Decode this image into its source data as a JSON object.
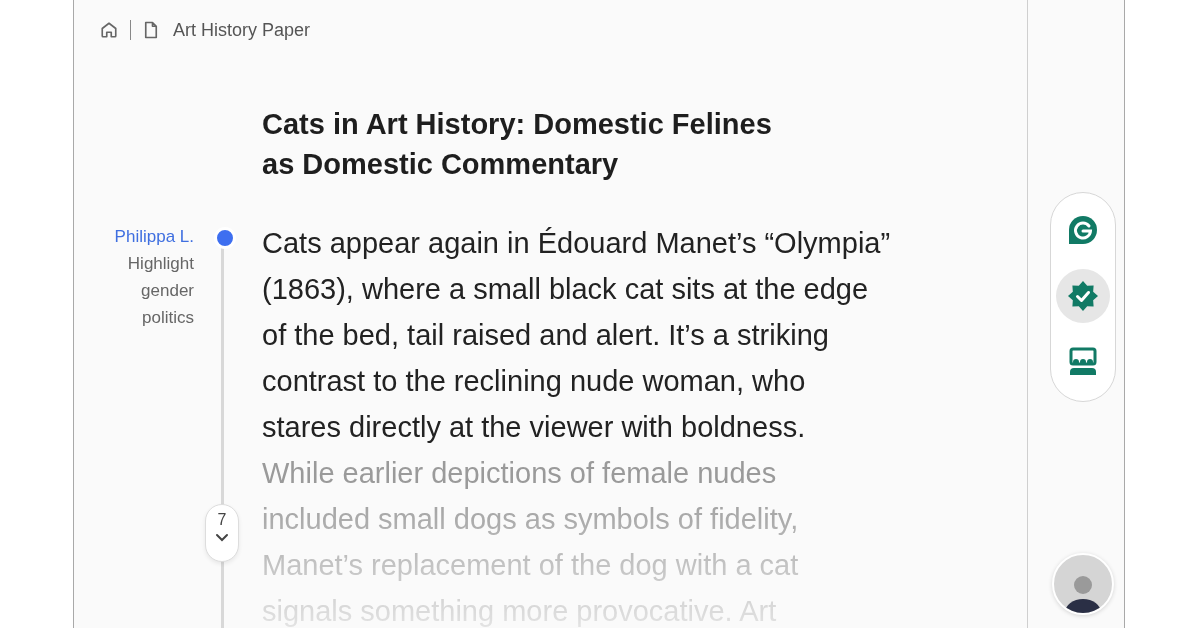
{
  "breadcrumb": {
    "title": "Art History Paper"
  },
  "document": {
    "title_lines": [
      "Cats in Art History: Domestic Felines",
      "as Domestic Commentary"
    ],
    "lines": [
      "Cats appear again in Édouard Manet’s “Olympia”",
      "(1863), where a small black cat sits at the edge",
      "of the bed, tail raised and alert. It’s a striking",
      "contrast to the reclining nude woman, who",
      "stares directly at the viewer with boldness."
    ],
    "faded_lines": [
      "While earlier depictions of female nudes",
      "included small dogs as symbols of fidelity,",
      "Manet’s replacement of the dog with a cat",
      "signals something more provocative. Art"
    ]
  },
  "comment": {
    "author": "Philippa L.",
    "text": "Highlight gender politics"
  },
  "comment_counter": "7",
  "side_toolbar": [
    {
      "kind": "g-logo",
      "selected": false
    },
    {
      "kind": "verified",
      "selected": true
    },
    {
      "kind": "group",
      "selected": false
    }
  ]
}
